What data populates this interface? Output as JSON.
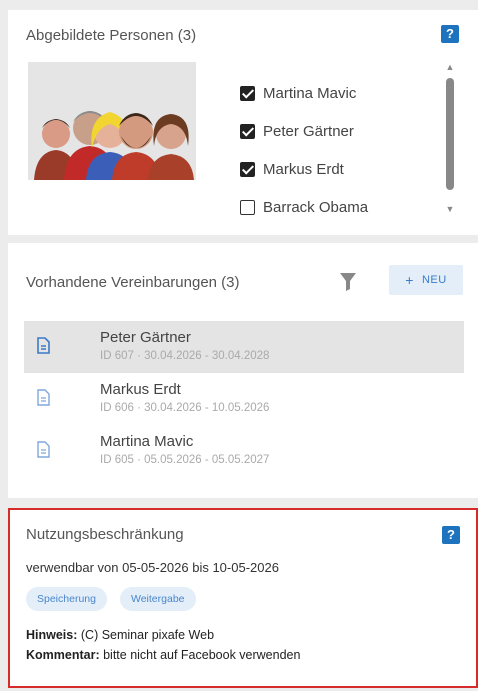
{
  "persons": {
    "title": "Abgebildete Personen (3)",
    "help": "?",
    "items": [
      {
        "name": "Martina Mavic",
        "checked": true
      },
      {
        "name": "Peter Gärtner",
        "checked": true
      },
      {
        "name": "Markus Erdt",
        "checked": true
      },
      {
        "name": "Barrack Obama",
        "checked": false
      }
    ]
  },
  "agreements": {
    "title": "Vorhandene Vereinbarungen (3)",
    "new_label": "NEU",
    "new_icon": "+",
    "items": [
      {
        "name": "Peter Gärtner",
        "meta": "ID 607 · 30.04.2026 - 30.04.2028",
        "selected": true
      },
      {
        "name": "Markus Erdt",
        "meta": "ID 606 · 30.04.2026 - 10.05.2026",
        "selected": false
      },
      {
        "name": "Martina Mavic",
        "meta": "ID 605 · 05.05.2026 - 05.05.2027",
        "selected": false
      }
    ]
  },
  "usage": {
    "title": "Nutzungsbeschränkung",
    "help": "?",
    "validity": "verwendbar von 05-05-2026 bis 10-05-2026",
    "tags": [
      "Speicherung",
      "Weitergabe"
    ],
    "hint_label": "Hinweis:",
    "hint_value": " (C) Seminar pixafe Web",
    "comment_label": "Kommentar:",
    "comment_value": " bitte nicht auf Facebook verwenden"
  },
  "colors": {
    "accent": "#1e73be",
    "highlight_border": "#d52b2b",
    "tag_bg": "#e3eef9"
  },
  "icons": {
    "help": "help-icon",
    "filter": "filter-icon",
    "document": "document-icon",
    "people": "people-image"
  }
}
